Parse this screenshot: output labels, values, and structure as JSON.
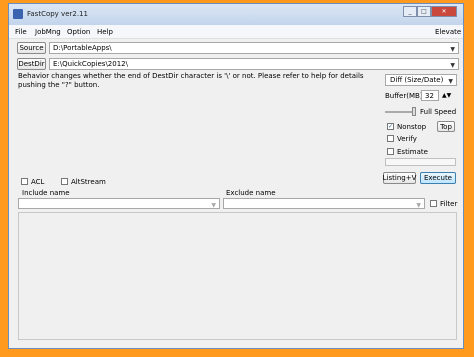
{
  "window": {
    "title": "FastCopy ver2.11"
  },
  "titlebar_icons": {
    "minimize": "minimize-icon",
    "maximize": "maximize-icon",
    "close": "close-icon"
  },
  "menu": {
    "file": "File",
    "jobmng": "JobMng",
    "option": "Option",
    "help": "Help",
    "elevate": "Elevate"
  },
  "source": {
    "button": "Source",
    "value": "D:\\PortableApps\\"
  },
  "destdir": {
    "button": "DestDir",
    "value": "E:\\QuickCopies\\2012\\"
  },
  "status_message": "Behavior changes whether the end of DestDir character is '\\' or not. Please refer to help for details pushing the \"?\" button.",
  "mode": {
    "selected": "Diff (Size/Date)"
  },
  "buffer": {
    "label": "Buffer(MB)",
    "value": "32"
  },
  "speed": {
    "label": "Full Speed"
  },
  "options": {
    "nonstop": {
      "label": "Nonstop",
      "checked": true
    },
    "verify": {
      "label": "Verify",
      "checked": false
    },
    "estimate": {
      "label": "Estimate",
      "checked": false
    },
    "top_button": "Top"
  },
  "actions": {
    "listing": "Listing+V",
    "execute": "Execute"
  },
  "attributes": {
    "acl": {
      "label": "ACL",
      "checked": false
    },
    "altstream": {
      "label": "AltStream",
      "checked": false
    }
  },
  "filters": {
    "include_label": "Include name",
    "exclude_label": "Exclude name",
    "filter_label": "Filter",
    "filter_checked": false
  }
}
